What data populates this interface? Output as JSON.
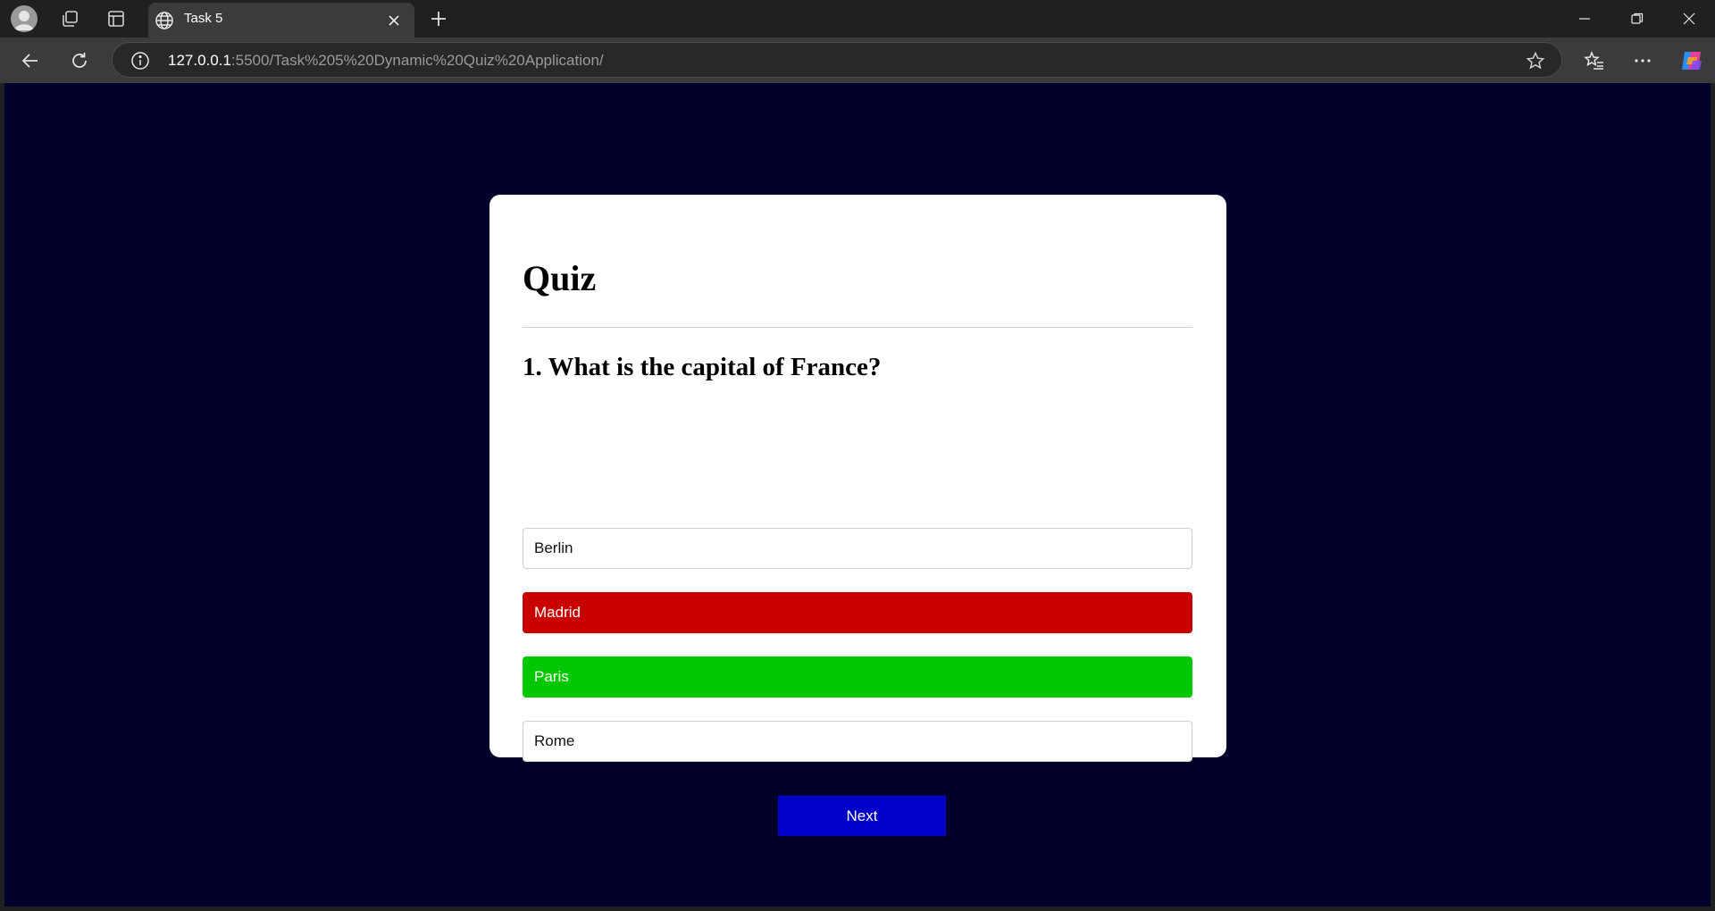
{
  "browser": {
    "tab_title": "Task 5",
    "url_host": "127.0.0.1",
    "url_rest": ":5500/Task%205%20Dynamic%20Quiz%20Application/"
  },
  "quiz": {
    "title": "Quiz",
    "question": "1. What is the capital of France?",
    "options": [
      {
        "label": "Berlin",
        "state": "neutral"
      },
      {
        "label": "Madrid",
        "state": "wrong"
      },
      {
        "label": "Paris",
        "state": "correct"
      },
      {
        "label": "Rome",
        "state": "neutral"
      }
    ],
    "next_label": "Next"
  },
  "colors": {
    "page_background": "#00002b",
    "wrong": "#c90000",
    "correct": "#00c800",
    "next_button": "#0000c8"
  },
  "icons": {
    "profile": "avatar-icon",
    "workspaces": "workspaces-icon",
    "tab_actions": "vertical-tabs-icon",
    "tab_site": "globe-icon",
    "tab_close": "close-icon",
    "new_tab": "plus-icon",
    "back": "back-arrow-icon",
    "reload": "reload-icon",
    "site_info": "info-icon",
    "favorite": "star-icon",
    "favorites": "favorites-icon",
    "more": "more-icon",
    "copilot": "copilot-icon"
  }
}
